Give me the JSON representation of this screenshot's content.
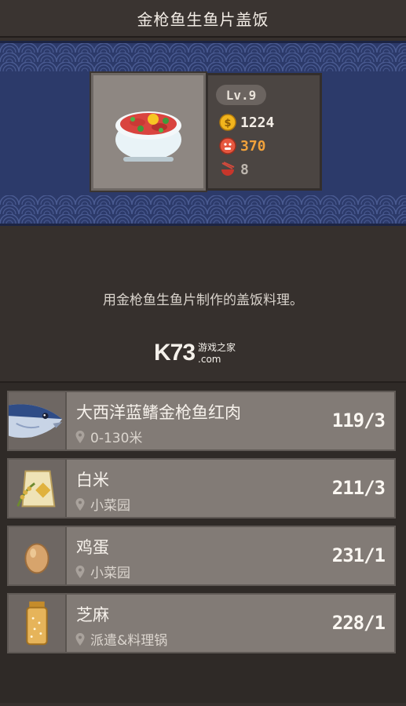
{
  "header": {
    "title": "金枪鱼生鱼片盖饭"
  },
  "dish": {
    "level": "Lv.9",
    "price": "1224",
    "popularity": "370",
    "served": "8",
    "icons": {
      "dish": "rice-bowl-icon",
      "price": "gold-coin-icon",
      "popularity": "customer-face-icon",
      "served": "bowl-chopsticks-icon"
    },
    "colors": {
      "price": "#f3ede6",
      "popularity": "#f2a23b",
      "served": "#bdb6ae"
    }
  },
  "description": "用金枪鱼生鱼片制作的盖饭料理。",
  "watermark": {
    "brand": "K73",
    "top": "游戏之家",
    "bottom": ".com"
  },
  "ingredients": [
    {
      "name": "大西洋蓝鳍金枪鱼红肉",
      "location": "0-130米",
      "count": "119/3",
      "icon": "tuna-icon"
    },
    {
      "name": "白米",
      "location": "小菜园",
      "count": "211/3",
      "icon": "rice-bag-icon"
    },
    {
      "name": "鸡蛋",
      "location": "小菜园",
      "count": "231/1",
      "icon": "egg-icon"
    },
    {
      "name": "芝麻",
      "location": "派遣&料理锅",
      "count": "228/1",
      "icon": "sesame-jar-icon"
    }
  ]
}
